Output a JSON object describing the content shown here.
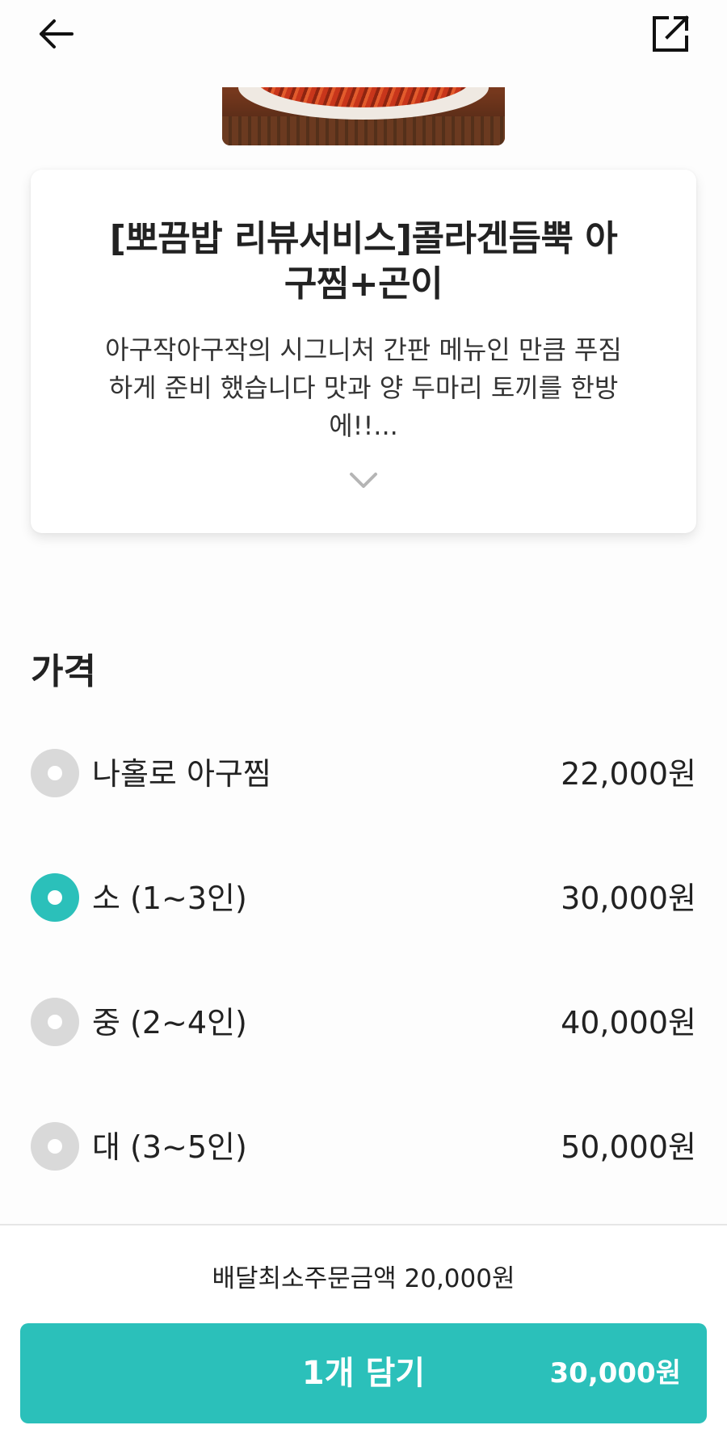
{
  "header": {
    "back_icon": "arrow-left-icon",
    "share_icon": "share-external-icon"
  },
  "menu": {
    "title": "[뽀끔밥 리뷰서비스]콜라겐듬뿍 아구찜+곤이",
    "description": "아구작아구작의 시그니처 간판 메뉴인 만큼 푸짐하게 준비 했습니다 맛과 양 두마리 토끼를 한방에!!...",
    "expand_icon": "chevron-down-icon"
  },
  "price_section": {
    "title": "가격",
    "options": [
      {
        "label": "나홀로 아구찜",
        "price": "22,000원",
        "selected": false
      },
      {
        "label": "소 (1~3인)",
        "price": "30,000원",
        "selected": true
      },
      {
        "label": "중 (2~4인)",
        "price": "40,000원",
        "selected": false
      },
      {
        "label": "대 (3~5인)",
        "price": "50,000원",
        "selected": false
      }
    ]
  },
  "footer": {
    "min_order": "배달최소주문금액 20,000원",
    "add_label": "1개 담기",
    "add_price": "30,000원"
  },
  "colors": {
    "accent": "#2bc0ba",
    "radio_unselected": "#d9d9d9",
    "text": "#222222"
  }
}
